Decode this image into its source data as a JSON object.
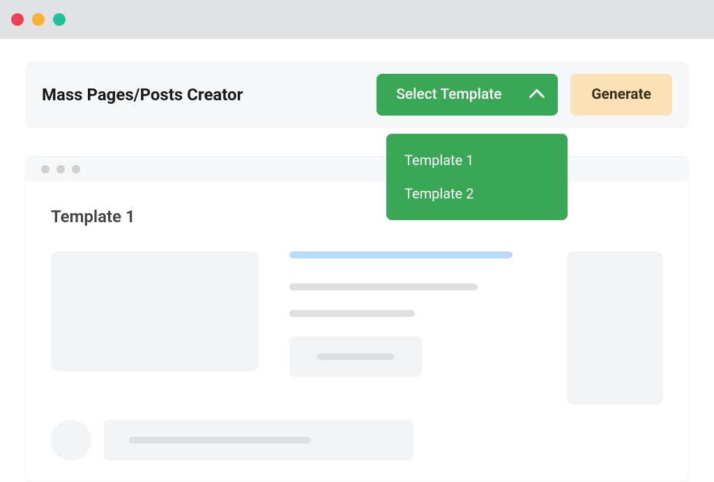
{
  "header": {
    "title": "Mass Pages/Posts Creator",
    "select_label": "Select Template",
    "generate_label": "Generate"
  },
  "dropdown": {
    "items": [
      {
        "label": "Template 1"
      },
      {
        "label": "Template 2"
      }
    ]
  },
  "preview": {
    "title": "Template 1"
  }
}
